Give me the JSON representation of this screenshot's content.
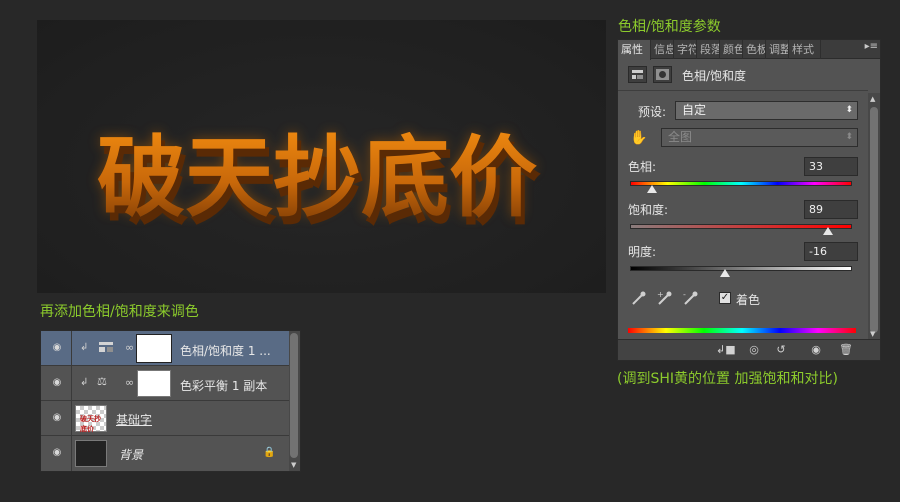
{
  "canvas": {
    "artwork_text": "破天抄底价",
    "text_color": "#d97a0a"
  },
  "labels": {
    "properties_title": "色相/饱和度参数",
    "layers_title": "再添加色相/饱和度来调色",
    "note": "(调到SHI黄的位置 加强饱和和对比)"
  },
  "properties": {
    "tabs": [
      "属性",
      "信息",
      "字符",
      "段落",
      "颜色",
      "色板",
      "调整",
      "样式"
    ],
    "menu_icon": "panel-menu-icon",
    "title": "色相/饱和度",
    "preset_label": "预设:",
    "preset_value": "自定",
    "channel_value": "全图",
    "hue_label": "色相:",
    "hue_value": "33",
    "saturation_label": "饱和度:",
    "saturation_value": "89",
    "lightness_label": "明度:",
    "lightness_value": "-16",
    "colorize_label": "着色",
    "colorize_checked": true
  },
  "layers": {
    "rows": [
      {
        "name": "色相/饱和度 1 ...",
        "selected": true
      },
      {
        "name": "色彩平衡 1 副本",
        "selected": false
      },
      {
        "name": "基础字",
        "thumb_text": "破天抄底价"
      },
      {
        "name": "背景",
        "locked": true
      }
    ]
  }
}
